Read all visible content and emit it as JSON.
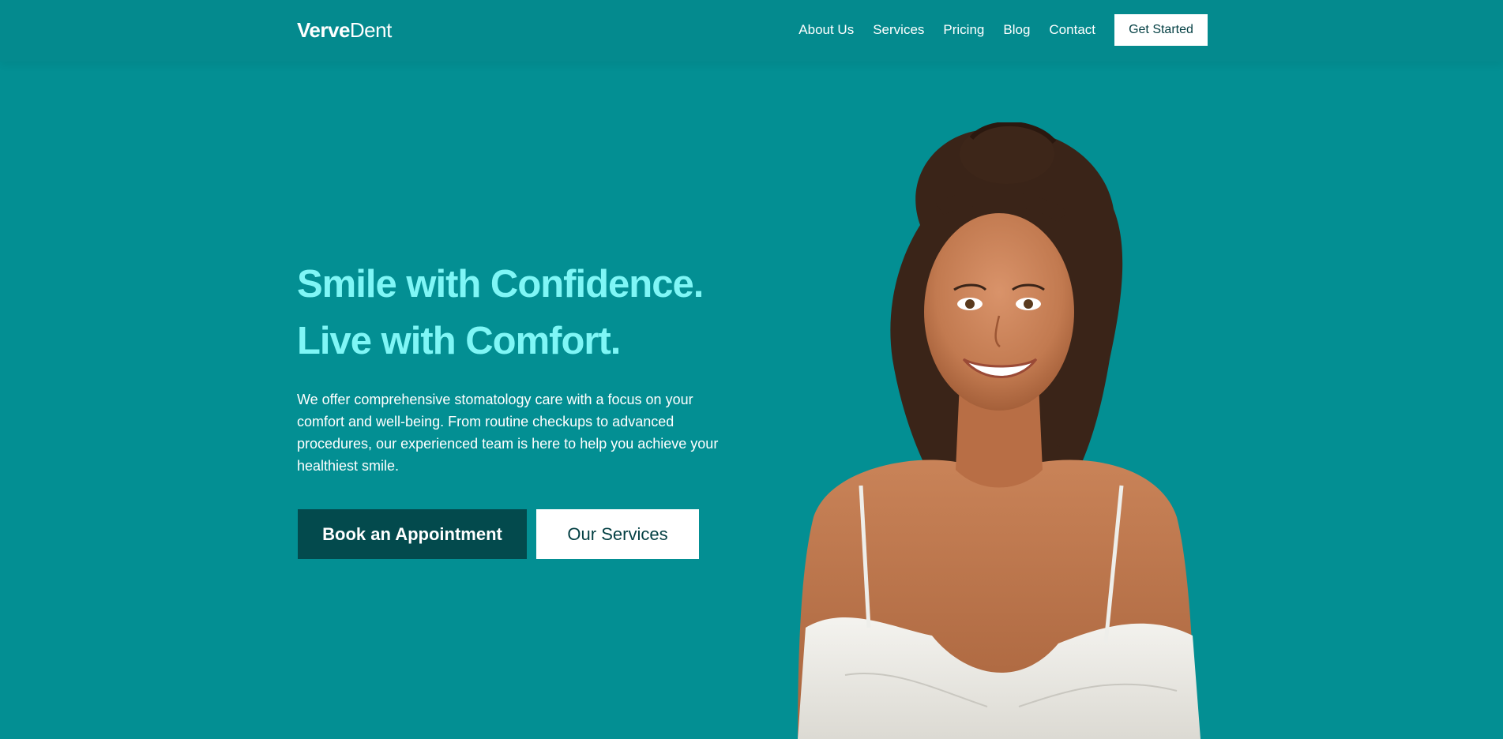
{
  "header": {
    "logo_bold": "Verve",
    "logo_light": "Dent",
    "nav": [
      "About Us",
      "Services",
      "Pricing",
      "Blog",
      "Contact"
    ],
    "cta_label": "Get Started"
  },
  "hero": {
    "title_line1": "Smile with Confidence.",
    "title_line2": "Live with Comfort.",
    "description": "We offer comprehensive stomatology care with a focus on your comfort and well-being. From routine checkups to advanced procedures, our experienced team is here to help you achieve your healthiest smile.",
    "primary_button": "Book an Appointment",
    "secondary_button": "Our Services"
  },
  "colors": {
    "background": "#038f93",
    "title": "#7ff6f6",
    "primary_button": "#034a4d",
    "secondary_button": "#ffffff"
  }
}
